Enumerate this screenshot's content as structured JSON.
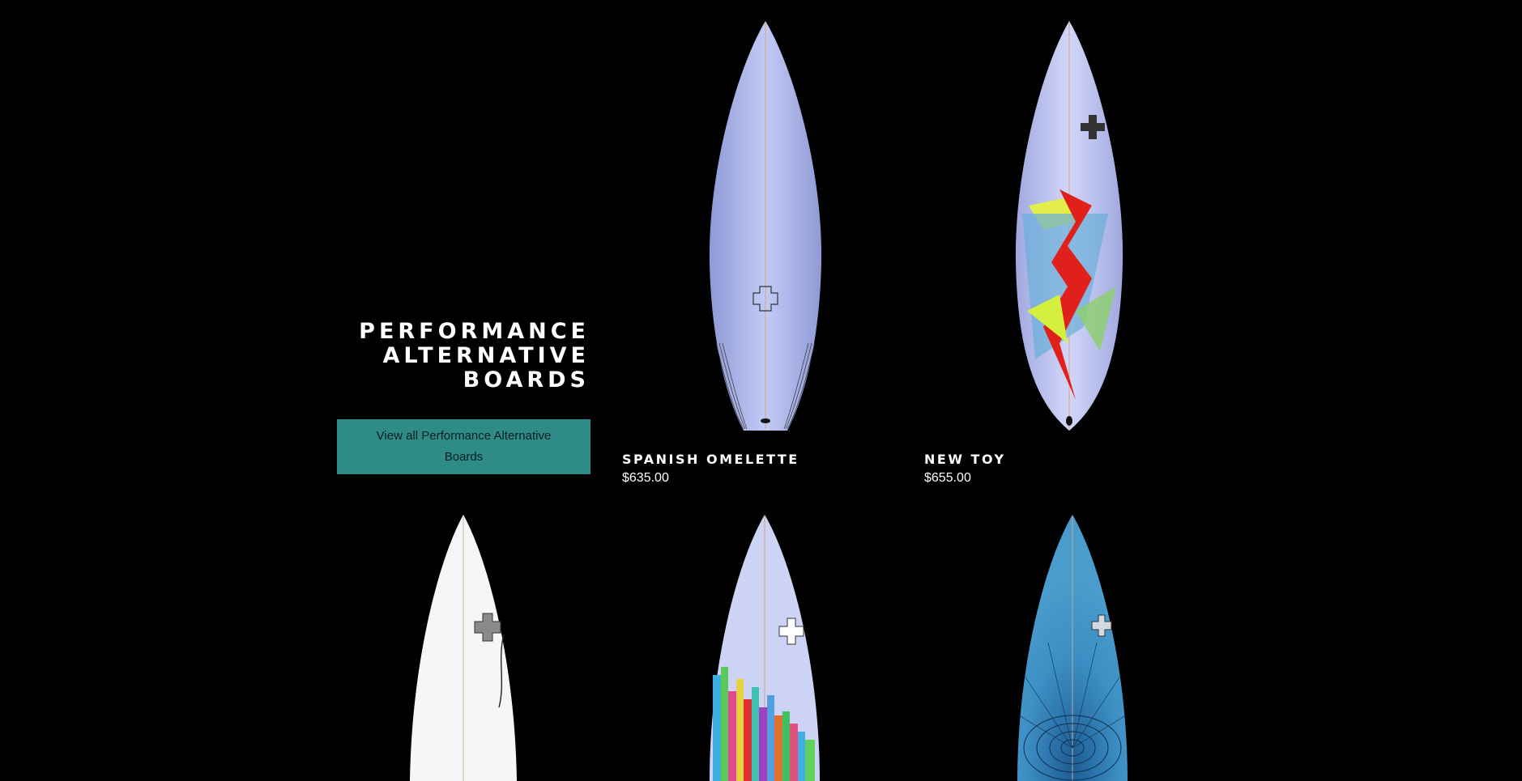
{
  "collection": {
    "title_lines": [
      "PERFORMANCE",
      "ALTERNATIVE",
      "BOARDS"
    ],
    "view_all_label": "View all Performance Alternative Boards"
  },
  "products": [
    {
      "name": "SPANISH OMELETTE",
      "price": "$635.00",
      "board_color": "#b8c3f0"
    },
    {
      "name": "NEW TOY",
      "price": "$655.00",
      "board_color": "#c5cbf2"
    },
    {
      "board_color": "#f4f4f6"
    },
    {
      "board_color": "#c8cff4"
    },
    {
      "board_color": "#3f8fc0"
    }
  ],
  "colors": {
    "background": "#000000",
    "button": "#2e8b87"
  }
}
